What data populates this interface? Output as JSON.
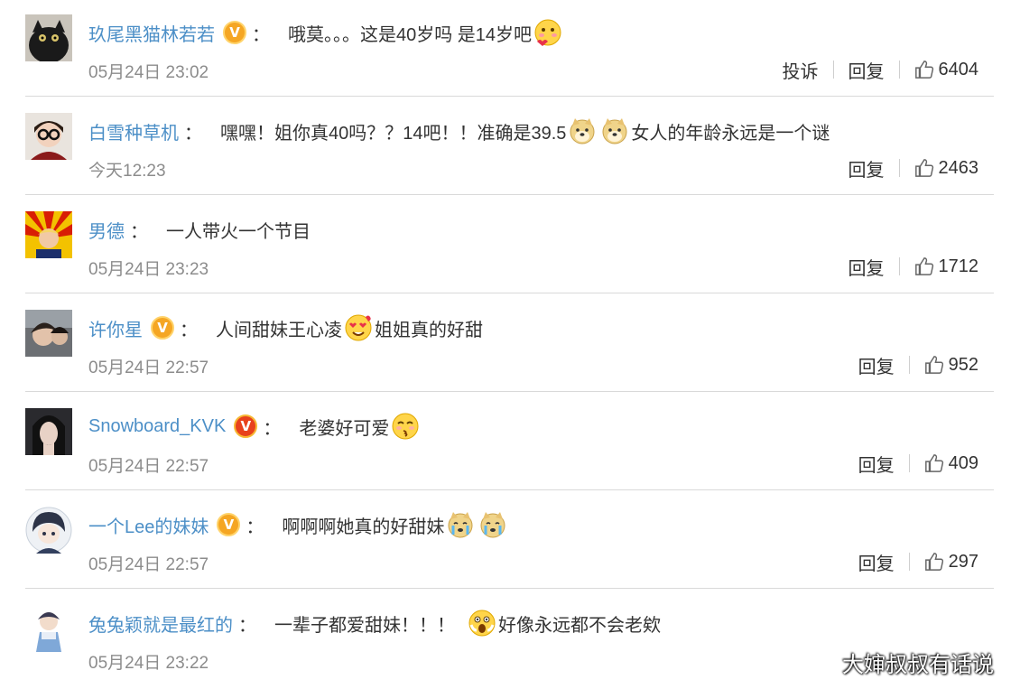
{
  "colors": {
    "username": "#4c8fc7",
    "timestamp": "#8c8c8c",
    "text": "#333333",
    "badge_gold": "#f5a623",
    "badge_red": "#e8411c"
  },
  "labels": {
    "report": "投诉",
    "reply": "回复",
    "colon": "："
  },
  "comments": [
    {
      "username": "玖尾黑猫林若若",
      "badge": "gold-v-badge",
      "text1": "哦莫。。。这是40岁吗 是14岁吧",
      "emoji1": "blush-heart-emoji",
      "text2": "",
      "text3": "",
      "time": "05月24日 23:02",
      "likes": "6404"
    },
    {
      "username": "白雪种草机",
      "text1": "嘿嘿！姐你真40吗？？14吧！！准确是39.5",
      "emoji1": "doge-emoji",
      "emoji2": "doge-emoji",
      "text2": "女人的年龄永远是一个谜",
      "time": "今天12:23",
      "likes": "2463"
    },
    {
      "username": "男德",
      "text1": "一人带火一个节目",
      "time": "05月24日 23:23",
      "likes": "1712"
    },
    {
      "username": "许你星",
      "badge": "gold-v-badge",
      "text1": "人间甜妹王心凌",
      "emoji1": "love-eyes-emoji",
      "text2": "姐姐真的好甜",
      "time": "05月24日 22:57",
      "likes": "952"
    },
    {
      "username": "Snowboard_KVK",
      "badge": "red-v-badge",
      "text1": "老婆好可爱",
      "emoji1": "kiss-emoji",
      "time": "05月24日 22:57",
      "likes": "409"
    },
    {
      "username": "一个Lee的妹妹",
      "badge": "gold-v-badge",
      "text1": "啊啊啊她真的好甜妹",
      "emoji1": "crying-doge-emoji",
      "emoji2": "crying-doge-emoji",
      "time": "05月24日 22:57",
      "likes": "297"
    },
    {
      "username": "兔兔颖就是最红的",
      "text1": "一辈子都爱甜妹！！！",
      "emoji1": "shocked-emoji",
      "text2": "好像永远都不会老欸",
      "time": "05月24日 23:22"
    }
  ],
  "watermark": "大婶叔叔有话说"
}
